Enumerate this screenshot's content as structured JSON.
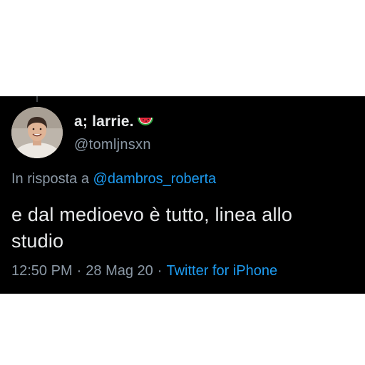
{
  "tweet": {
    "display_name": "a; larrie.",
    "name_emoji_icon": "watermelon-icon",
    "handle": "@tomljnsxn",
    "reply_prefix": "In risposta a",
    "reply_to_handle": "@dambros_roberta",
    "text_line_1": "e dal medioevo è tutto, linea allo",
    "text_line_2": "studio",
    "time": "12:50 PM",
    "separator": "·",
    "date": "28 Mag 20",
    "source": "Twitter for iPhone"
  },
  "colors": {
    "card_background": "#000000",
    "page_background": "#ffffff",
    "primary_text": "#e7e9ea",
    "secondary_text": "#8b98a5",
    "link": "#1d9bf0"
  }
}
